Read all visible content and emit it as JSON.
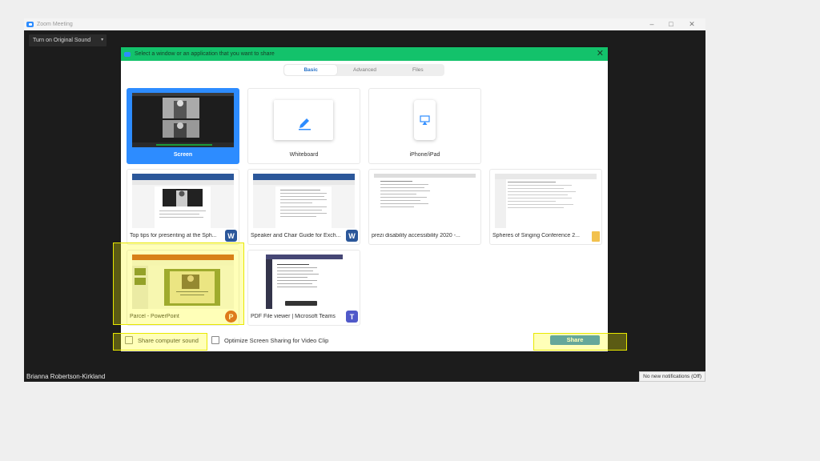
{
  "window": {
    "title": "Zoom Meeting",
    "controls": {
      "minimize": "–",
      "maximize": "□",
      "close": "✕"
    }
  },
  "toolbar": {
    "sound_button": "Turn on Original Sound",
    "sound_dropdown": "▾"
  },
  "dialog": {
    "title": "Select a window or an application that you want to share",
    "close": "✕",
    "tabs": [
      {
        "label": "Basic",
        "active": true
      },
      {
        "label": "Advanced",
        "active": false
      },
      {
        "label": "Files",
        "active": false
      }
    ],
    "tiles": [
      {
        "label": "Screen",
        "selected": true,
        "icon": "monitor-thumbnail"
      },
      {
        "label": "Whiteboard",
        "selected": false,
        "icon": "pencil-icon"
      },
      {
        "label": "iPhone/iPad",
        "selected": false,
        "icon": "airplay-icon"
      }
    ],
    "apps": [
      {
        "label": "Top tips for presenting at the Sph...",
        "badge": "W",
        "badge_color": "#2b579a"
      },
      {
        "label": "Speaker and Chair Guide for Exch...",
        "badge": "W",
        "badge_color": "#2b579a"
      },
      {
        "label": "prezi disability accessibility 2020 -...",
        "badge": "",
        "badge_color": ""
      },
      {
        "label": "Spheres of Singing Conference 2...",
        "badge": "",
        "badge_color": "#f2c14e"
      },
      {
        "label": "Parcel - PowerPoint",
        "badge": "P",
        "badge_color": "#d24726"
      },
      {
        "label": "PDF File viewer | Microsoft Teams",
        "badge": "T",
        "badge_color": "#5059c9"
      }
    ],
    "share_sound_label": "Share computer sound",
    "optimize_label": "Optimize Screen Sharing for Video Clip",
    "share_button": "Share"
  },
  "participant_name": "Brianna Robertson-Kirkland",
  "notification": "No new notifications (Off)",
  "colors": {
    "accent": "#2d8cff",
    "header_green": "#13c26b",
    "highlight": "#ffff00"
  }
}
